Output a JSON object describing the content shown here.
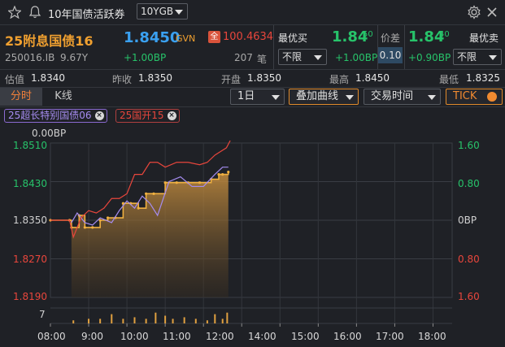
{
  "window": {
    "title": "10年国债活跃券",
    "selector": "10YGB"
  },
  "quote": {
    "name": "25附息国债16",
    "price": "1.8450",
    "source": "GVN",
    "full_badge": "全",
    "full_price": "100.4634",
    "code": "250016.IB",
    "tenor": "9.67Y",
    "change_bp": "+1.00BP",
    "volume": "207",
    "volume_unit": "笔",
    "best_bid_label": "最优买",
    "best_bid_main": "1.84",
    "best_bid_sub": "50",
    "bid_filter": "不限",
    "bid_change": "+1.00BP",
    "spread_label": "价差",
    "spread_value": "0.10",
    "best_ask_main": "1.84",
    "best_ask_sub": "40",
    "best_ask_label": "最优卖",
    "ask_change": "+0.90BP",
    "ask_filter": "不限"
  },
  "stats": {
    "est_label": "估值",
    "est_value": "1.8340",
    "prev_label": "昨收",
    "prev_value": "1.8350",
    "open_label": "开盘",
    "open_value": "1.8350",
    "high_label": "最高",
    "high_value": "1.8450",
    "low_label": "最低",
    "low_value": "1.8325"
  },
  "toolbar": {
    "tab_intraday": "分时",
    "tab_kline": "K线",
    "period": "1日",
    "overlay": "叠加曲线",
    "trade_time": "交易时间",
    "tick": "TICK"
  },
  "overlays": [
    {
      "label": "25超长特别国债06",
      "color": "#a58cf0"
    },
    {
      "label": "25国开15",
      "color": "#e8463c"
    }
  ],
  "chart": {
    "top_label": "0.00BP",
    "left_ticks": [
      "1.8510",
      "1.8430",
      "1.8350",
      "1.8270",
      "1.8190"
    ],
    "right_ticks": [
      "1.60",
      "0.80",
      "0BP",
      "0.80",
      "1.60"
    ],
    "volume_tick": "7",
    "time_ticks": [
      "08:00",
      "9:00",
      "10:00",
      "11:00",
      "12:00",
      "14:00",
      "15:00",
      "16:00",
      "17:00",
      "18:00"
    ]
  },
  "chart_data": {
    "type": "line",
    "ylim": [
      1.819,
      1.851
    ],
    "x_unit": "hours",
    "series": [
      {
        "name": "25附息国债16",
        "color": "#f0b040",
        "x": [
          8.0,
          8.5,
          8.55,
          8.75,
          8.9,
          9.1,
          9.3,
          9.5,
          9.7,
          9.9,
          10.1,
          10.3,
          10.5,
          10.7,
          11.0,
          11.3,
          11.6,
          11.9,
          12.2,
          12.4,
          12.5,
          12.65
        ],
        "y": [
          1.835,
          1.835,
          1.8335,
          1.836,
          1.8335,
          1.8335,
          1.835,
          1.8355,
          1.8355,
          1.8385,
          1.8385,
          1.8375,
          1.8405,
          1.8405,
          1.8428,
          1.8428,
          1.8428,
          1.8428,
          1.8435,
          1.8445,
          1.8445,
          1.845
        ]
      },
      {
        "name": "25超长特别国债06",
        "color": "#a58cf0",
        "x": [
          8.55,
          8.7,
          8.9,
          9.1,
          9.3,
          9.6,
          9.8,
          10.0,
          10.2,
          10.4,
          10.6,
          10.8,
          11.1,
          11.4,
          11.7,
          12.0,
          12.3,
          12.5,
          12.65
        ],
        "y": [
          1.8345,
          1.8365,
          1.8345,
          1.834,
          1.8355,
          1.8345,
          1.837,
          1.839,
          1.8375,
          1.84,
          1.8385,
          1.836,
          1.843,
          1.844,
          1.842,
          1.842,
          1.8445,
          1.846,
          1.846
        ]
      },
      {
        "name": "25国开15",
        "color": "#e8463c",
        "x": [
          8.0,
          8.5,
          8.6,
          8.8,
          9.0,
          9.2,
          9.4,
          9.6,
          9.8,
          10.0,
          10.2,
          10.4,
          10.6,
          10.8,
          11.0,
          11.3,
          11.6,
          11.9,
          12.1,
          12.3,
          12.5,
          12.6,
          12.7
        ],
        "y": [
          1.835,
          1.835,
          1.8315,
          1.8355,
          1.837,
          1.8365,
          1.8375,
          1.8395,
          1.8395,
          1.8405,
          1.8445,
          1.8445,
          1.847,
          1.847,
          1.846,
          1.847,
          1.847,
          1.8465,
          1.847,
          1.8485,
          1.8495,
          1.85,
          1.8515
        ]
      }
    ],
    "volume": {
      "ylim": [
        0,
        10
      ],
      "x": [
        8.6,
        9.0,
        9.3,
        9.6,
        9.9,
        10.2,
        10.5,
        10.75,
        11.0,
        11.2,
        11.5,
        11.8,
        12.1,
        12.3,
        12.5,
        12.62
      ],
      "y": [
        2,
        3,
        3,
        6,
        3,
        4,
        3,
        7,
        5,
        3,
        4,
        3,
        2,
        6,
        3,
        7
      ]
    }
  }
}
